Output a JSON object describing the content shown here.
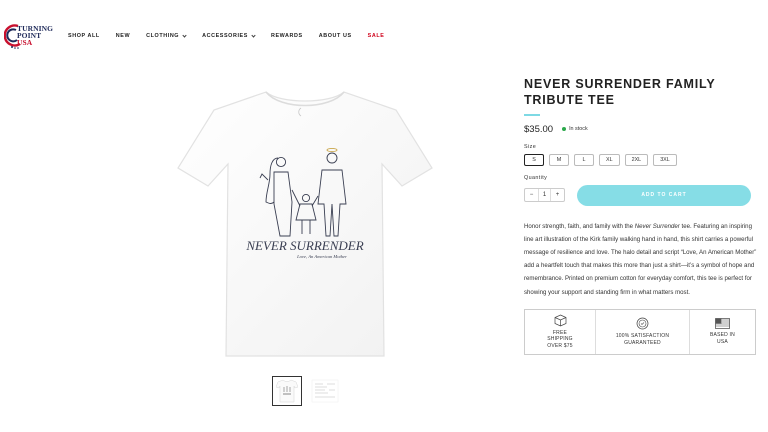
{
  "header": {
    "logo": {
      "line1": "TURNING",
      "line2": "POINT",
      "line3": "USA"
    },
    "nav": [
      {
        "label": "SHOP ALL",
        "dropdown": false,
        "sale": false
      },
      {
        "label": "NEW",
        "dropdown": false,
        "sale": false
      },
      {
        "label": "CLOTHING",
        "dropdown": true,
        "sale": false
      },
      {
        "label": "ACCESSORIES",
        "dropdown": true,
        "sale": false
      },
      {
        "label": "REWARDS",
        "dropdown": false,
        "sale": false
      },
      {
        "label": "ABOUT US",
        "dropdown": false,
        "sale": false
      },
      {
        "label": "SALE",
        "dropdown": false,
        "sale": true
      }
    ]
  },
  "product": {
    "shirt_text": "NEVER SURRENDER",
    "shirt_script": "Love, An American Mother",
    "title": "NEVER SURRENDER FAMILY TRIBUTE TEE",
    "price": "$35.00",
    "stock": "In stock",
    "size_label": "Size",
    "sizes": [
      "S",
      "M",
      "L",
      "XL",
      "2XL",
      "3XL"
    ],
    "selected_size": "S",
    "quantity_label": "Quantity",
    "quantity": "1",
    "minus": "−",
    "plus": "+",
    "add_to_cart": "ADD TO CART",
    "description_before": "Honor strength, faith, and family with the ",
    "description_em": "Never Surrender",
    "description_after": " tee. Featuring an inspiring line art illustration of the Kirk family walking hand in hand, this shirt carries a powerful message of resilience and love. The halo detail and script “Love, An American Mother” add a heartfelt touch that makes this more than just a shirt—it’s a symbol of hope and remembrance. Printed on premium cotton for everyday comfort, this tee is perfect for showing your support and standing firm in what matters most."
  },
  "badges": [
    {
      "icon": "box-icon",
      "line1": "FREE",
      "line2": "SHIPPING",
      "line3": "OVER $75"
    },
    {
      "icon": "satisfaction-seal-icon",
      "line1": "100% SATISFACTION",
      "line2": "GUARANTEED",
      "line3": ""
    },
    {
      "icon": "usa-flag-icon",
      "line1": "BASED IN",
      "line2": "USA",
      "line3": ""
    }
  ],
  "colors": {
    "accent": "#86dde6",
    "sale": "#d0021b",
    "in_stock": "#2aa84a",
    "brand_navy": "#1f2a5a"
  }
}
